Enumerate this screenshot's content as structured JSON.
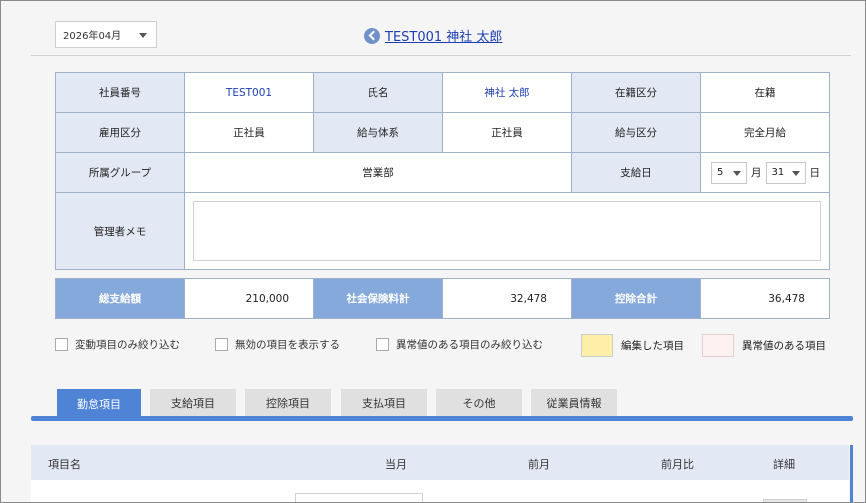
{
  "month_selector": {
    "value": "2026年04月"
  },
  "employee": {
    "title": "TEST001 神社 太郎"
  },
  "info_table": {
    "emp_no_label": "社員番号",
    "emp_no": "TEST001",
    "name_label": "氏名",
    "name": "神社 太郎",
    "status_label": "在籍区分",
    "status": "在籍",
    "employment_label": "雇用区分",
    "employment": "正社員",
    "pay_system_label": "給与体系",
    "pay_system": "正社員",
    "pay_class_label": "給与区分",
    "pay_class": "完全月給",
    "group_label": "所属グループ",
    "group": "営業部",
    "pay_date_label": "支給日",
    "pay_month": "5",
    "month_unit": "月",
    "pay_day": "31",
    "day_unit": "日",
    "memo_label": "管理者メモ",
    "memo": ""
  },
  "totals": {
    "gross_label": "総支給額",
    "gross": "210,000",
    "social_label": "社会保険料計",
    "social": "32,478",
    "deduction_label": "控除合計",
    "deduction": "36,478"
  },
  "filters": {
    "changed_only": "変動項目のみ絞り込む",
    "show_invalid": "無効の項目を表示する",
    "abnormal_only": "異常値のある項目のみ絞り込む",
    "edited_legend": "編集した項目",
    "abnormal_legend": "異常値のある項目"
  },
  "colors": {
    "edited": "#fdeea8",
    "abnormal": "#fdf1f1",
    "accent": "#4f83d6"
  },
  "tabs": [
    "勤怠項目",
    "支給項目",
    "控除項目",
    "支払項目",
    "その他",
    "従業員情報"
  ],
  "list_header": {
    "item_name": "項目名",
    "current": "当月",
    "previous": "前月",
    "ratio": "前月比",
    "detail": "詳細"
  }
}
